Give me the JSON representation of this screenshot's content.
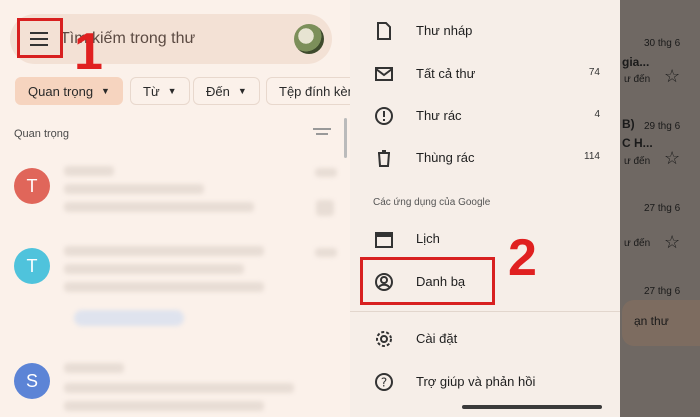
{
  "search": {
    "placeholder_visible": "Tìm kiếm trong thư"
  },
  "annotations": {
    "step1": "1",
    "step2": "2"
  },
  "chips": [
    {
      "label": "Quan trọng",
      "selected": true
    },
    {
      "label": "Từ"
    },
    {
      "label": "Đến"
    },
    {
      "label": "Tệp đính kèm"
    }
  ],
  "list": {
    "section_label": "Quan trọng",
    "avatars": [
      {
        "letter": "T",
        "color": "#e0665a"
      },
      {
        "letter": "T",
        "color": "#4fc3dc"
      },
      {
        "letter": "S",
        "color": "#5c84d6"
      }
    ]
  },
  "drawer": {
    "items_top": [
      {
        "label": "Thư nháp",
        "count": "",
        "icon": "draft-icon"
      },
      {
        "label": "Tất cả thư",
        "count": "74",
        "icon": "all-mail-icon"
      },
      {
        "label": "Thư rác",
        "count": "4",
        "icon": "spam-icon"
      },
      {
        "label": "Thùng rác",
        "count": "114",
        "icon": "trash-icon"
      }
    ],
    "apps_label": "Các ứng dụng của Google",
    "apps": [
      {
        "label": "Lịch",
        "icon": "calendar-icon"
      },
      {
        "label": "Danh bạ",
        "icon": "contacts-icon"
      }
    ],
    "bottom": [
      {
        "label": "Cài đặt",
        "icon": "settings-icon"
      },
      {
        "label": "Trợ giúp và phản hồi",
        "icon": "help-icon"
      }
    ]
  },
  "behind": {
    "dates": [
      "30 thg 6",
      "29 thg 6",
      "27 thg 6",
      "27 thg 6"
    ],
    "snippets": [
      "gia...",
      "B)",
      "C H..."
    ],
    "small": [
      "ư đến",
      "ư đến",
      "ư đến"
    ],
    "compose_label": "ạn thư"
  }
}
